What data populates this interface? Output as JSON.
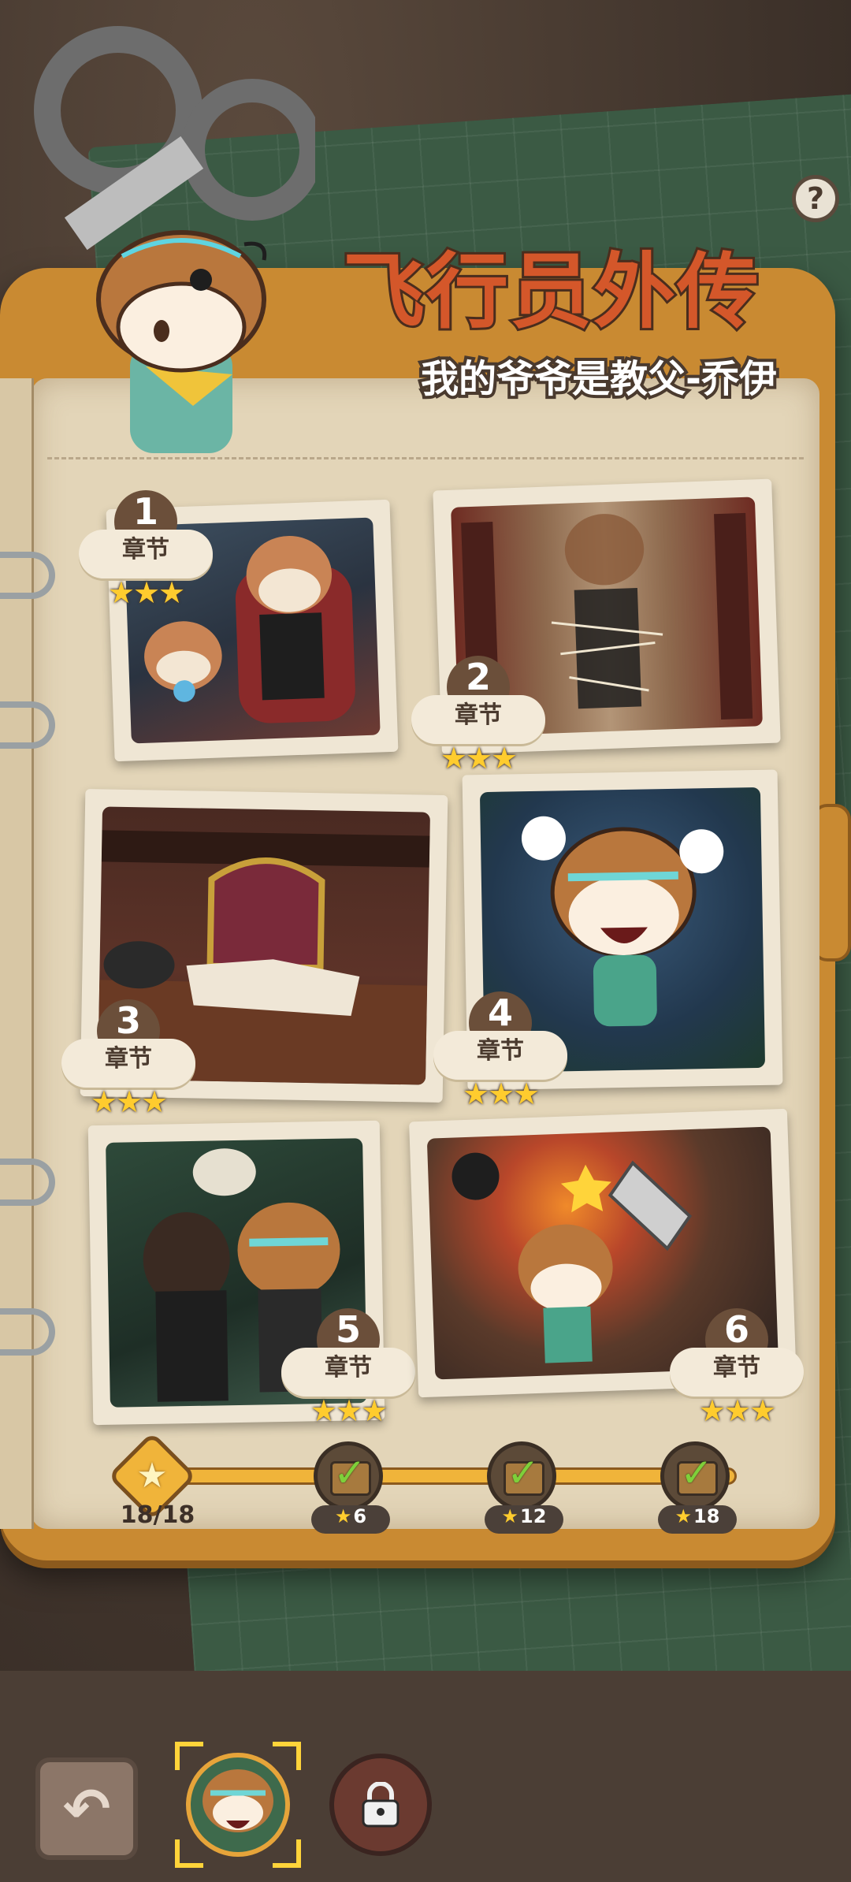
{
  "header": {
    "title": "飞行员外传",
    "subtitle": "我的爷爷是教父-乔伊",
    "help_label": "?"
  },
  "chapters": [
    {
      "number": "1",
      "label": "章节",
      "stars": "★★★"
    },
    {
      "number": "2",
      "label": "章节",
      "stars": "★★★"
    },
    {
      "number": "3",
      "label": "章节",
      "stars": "★★★"
    },
    {
      "number": "4",
      "label": "章节",
      "stars": "★★★"
    },
    {
      "number": "5",
      "label": "章节",
      "stars": "★★★"
    },
    {
      "number": "6",
      "label": "章节",
      "stars": "★★★"
    }
  ],
  "progress": {
    "text": "18/18",
    "rewards": [
      {
        "threshold": "6"
      },
      {
        "threshold": "12"
      },
      {
        "threshold": "18"
      }
    ]
  },
  "colors": {
    "title_fill": "#d4572a",
    "star": "#ffcc2e",
    "binder": "#c98a32",
    "page": "#e3d5b8"
  },
  "icons": [
    "help-icon",
    "star-icon",
    "chest-check-icon",
    "back-arrow-icon",
    "lock-icon"
  ]
}
